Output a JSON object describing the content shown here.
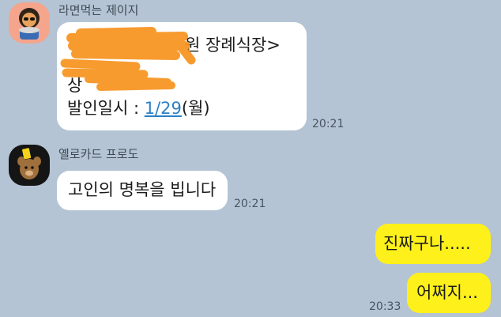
{
  "messages": [
    {
      "sender": "라면먹는 제이지",
      "lines": [
        {
          "text": "원 장례식장>"
        },
        {
          "text": "상"
        },
        {
          "prefix": "발인일시 : ",
          "link": "1/29",
          "suffix": "(월)"
        }
      ],
      "time": "20:21"
    },
    {
      "sender": "옐로카드 프로도",
      "text": "고인의 명복을 빕니다",
      "time": "20:21"
    },
    {
      "sender": "me",
      "texts": [
        "진짜구나.....",
        "어쩌지..."
      ],
      "time": "20:33"
    }
  ],
  "colors": {
    "background": "#b4c4d4",
    "incoming_bubble": "#ffffff",
    "outgoing_bubble": "#fef01b",
    "link": "#2c80c6",
    "redaction": "#f7931e"
  }
}
